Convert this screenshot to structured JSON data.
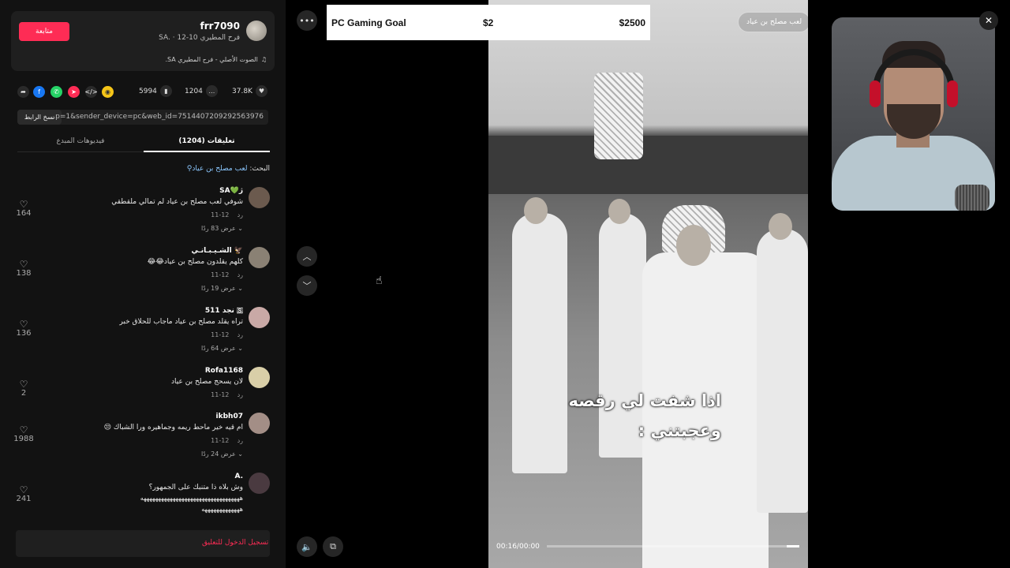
{
  "author": {
    "username": "frr7090",
    "subtitle": "فرح المطيري SA. · 12-10",
    "follow_label": "متابعة",
    "music": "الصوت الأصلي - فرح المطيري SA."
  },
  "stats": {
    "likes": "37.8K",
    "comments": "1204",
    "saves": "5994"
  },
  "link": {
    "url": "...p=1&sender_device=pc&web_id=7514407209292563976",
    "copy_label": "نسخ الرابط"
  },
  "tabs": {
    "comments": "تعليقات (1204)",
    "creator_videos": "فيديوهات المبدع"
  },
  "search": {
    "prefix": "البحث: ",
    "keyword": "لعب مصلح بن عياد",
    "icon": "search-icon"
  },
  "comments": [
    {
      "user": "SA💚ژ",
      "text": "شوفي لعب مصلح بن عياد لم تمالي ملقطقي",
      "date": "12-11",
      "reply": "رد",
      "replies": "عرض 83 ردًا",
      "likes": "164",
      "avatar_color": "#6b5a4e"
    },
    {
      "user": "الشـيـبـانـي 🦅",
      "text": "كلهم يقلدون مصلح بن عياد😂😂",
      "date": "12-11",
      "reply": "رد",
      "replies": "عرض 19 ردًا",
      "likes": "138",
      "avatar_color": "#8a8174"
    },
    {
      "user": "نجد 511 🇸",
      "text": "تراه يقلد مصلح بن عياد ماجاب للحلاق خبر",
      "date": "12-11",
      "reply": "رد",
      "replies": "عرض 64 ردًا",
      "likes": "136",
      "avatar_color": "#c9a9a6"
    },
    {
      "user": "Rofa1168",
      "text": "لان يسحج مصلح بن عياد",
      "date": "12-11",
      "reply": "رد",
      "replies": "",
      "likes": "2",
      "avatar_color": "#d9cfa8"
    },
    {
      "user": "ikbh07",
      "text": "ام قيه خير ماحط ريمه وجماهيره ورا الشباك 😒",
      "date": "12-11",
      "reply": "رد",
      "replies": "عرض 24 ردًا",
      "likes": "1988",
      "avatar_color": "#a38e86"
    },
    {
      "user": "A.",
      "text": "وش بلاه ذا متنبك على الجمهور؟",
      "text2": "ههههههههههههههههههههههههههههههههههه",
      "text3": "هههههههههههههه",
      "date": "",
      "reply": "",
      "replies": "",
      "likes": "241",
      "avatar_color": "#4a3a40"
    }
  ],
  "login": {
    "label": "تسجيل الدخول للتعليق"
  },
  "goal": {
    "title": "PC Gaming Goal",
    "current": "$2",
    "target": "$2500"
  },
  "video": {
    "search_chip": "لعب مصلح بن عياد",
    "caption_line1": "اذا شفت لي رقصه",
    "caption_line2": "وعجبتني :",
    "time": "00:16/00:00",
    "progress": 0.05
  },
  "controls": {
    "more_icon": "more-dots-icon",
    "up_icon": "chevron-up-icon",
    "down_icon": "chevron-down-icon",
    "volume_icon": "volume-icon",
    "pip_icon": "picture-in-picture-icon",
    "close_icon": "close-icon"
  },
  "colors": {
    "accent": "#fe2c55",
    "panel": "#121212",
    "goal_bg": "#ffffff"
  }
}
